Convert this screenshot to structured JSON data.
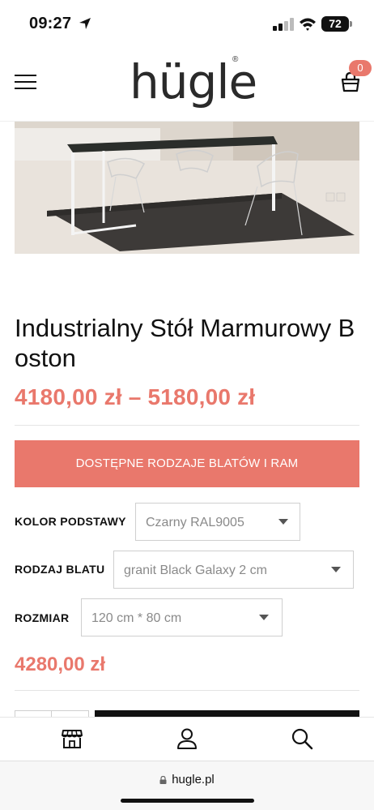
{
  "status_bar": {
    "time": "09:27",
    "battery": "72"
  },
  "header": {
    "logo": "hügle",
    "logo_mark": "®",
    "cart_count": "0"
  },
  "product": {
    "title": "Industrialny Stół Marmurowy Boston",
    "price_range": "4180,00 zł – 5180,00 zł",
    "variants_button": "DOSTĘPNE RODZAJE BLATÓW I RAM",
    "options": [
      {
        "label": "KOLOR PODSTAWY",
        "value": "Czarny RAL9005"
      },
      {
        "label": "RODZAJ BLATU",
        "value": "granit Black Galaxy 2 cm"
      },
      {
        "label": "ROZMIAR",
        "value": "120 cm * 80 cm"
      }
    ],
    "final_price": "4280,00 zł"
  },
  "bottom_nav": {
    "items": [
      "store-icon",
      "user-icon",
      "search-icon"
    ]
  },
  "browser": {
    "url": "hugle.pl"
  },
  "colors": {
    "accent": "#e9786c",
    "text": "#111111",
    "muted": "#8a8a8a"
  }
}
